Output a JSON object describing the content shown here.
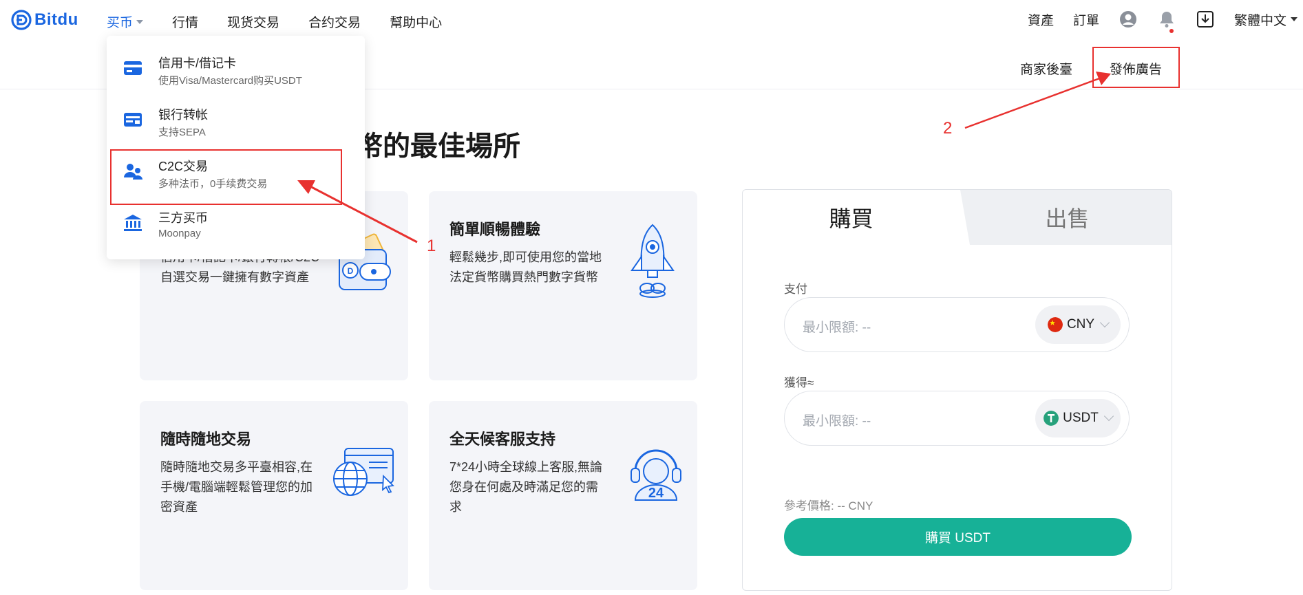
{
  "brand": {
    "name": "Bitdu",
    "color": "#1a66e0"
  },
  "nav": {
    "items": [
      {
        "label": "买币",
        "active": true,
        "has_caret": true
      },
      {
        "label": "行情"
      },
      {
        "label": "现货交易"
      },
      {
        "label": "合约交易"
      },
      {
        "label": "幫助中心"
      }
    ]
  },
  "right_nav": {
    "assets": "資產",
    "orders": "訂單",
    "account_icon": "user-circle-icon",
    "notification_icon": "bell-icon",
    "download_icon": "download-icon",
    "language": "繁體中文"
  },
  "subnav": {
    "merchant": "商家後臺",
    "post_ad": "發佈廣告"
  },
  "dropdown": {
    "items": [
      {
        "icon": "credit-card-icon",
        "title": "信用卡/借记卡",
        "subtitle": "使用Visa/Mastercard购买USDT"
      },
      {
        "icon": "bank-transfer-icon",
        "title": "银行转帐",
        "subtitle": "支持SEPA"
      },
      {
        "icon": "users-icon",
        "title": "C2C交易",
        "subtitle": "多种法币，0手续费交易"
      },
      {
        "icon": "bank-building-icon",
        "title": "三方买币",
        "subtitle": "Moonpay"
      }
    ]
  },
  "headline": "幣的最佳場所",
  "cards": [
    {
      "title": "",
      "text_line1": "信用卡/借記卡/銀行轉帳/C2C",
      "text_line2": "自選交易一鍵擁有數字資產",
      "icon": "wallet-icon"
    },
    {
      "title": "簡單順暢體驗",
      "text_line1": "輕鬆幾步,即可使用您的當地",
      "text_line2": "法定貨幣購買熱門數字貨幣",
      "icon": "rocket-icon"
    },
    {
      "title": "隨時隨地交易",
      "text_line1": "隨時隨地交易多平臺相容,在",
      "text_line2": "手機/電腦端輕鬆管理您的加",
      "text_line3": "密資產",
      "icon": "globe-browser-icon"
    },
    {
      "title": "全天候客服支持",
      "text_line1": "7*24小時全球線上客服,無論",
      "text_line2": "您身在何處及時滿足您的需",
      "text_line3": "求",
      "icon": "headset-24-icon"
    }
  ],
  "trade": {
    "tab_buy": "購買",
    "tab_sell": "出售",
    "pay_label": "支付",
    "pay_placeholder": "最小限額: --",
    "pay_currency": "CNY",
    "get_label": "獲得≈",
    "get_placeholder": "最小限額: --",
    "get_currency": "USDT",
    "reference": "參考價格: -- CNY",
    "buy_button": "購買 USDT",
    "accent": "#17b197"
  },
  "annotations": {
    "one": "1",
    "two": "2",
    "color": "#e8312f"
  }
}
